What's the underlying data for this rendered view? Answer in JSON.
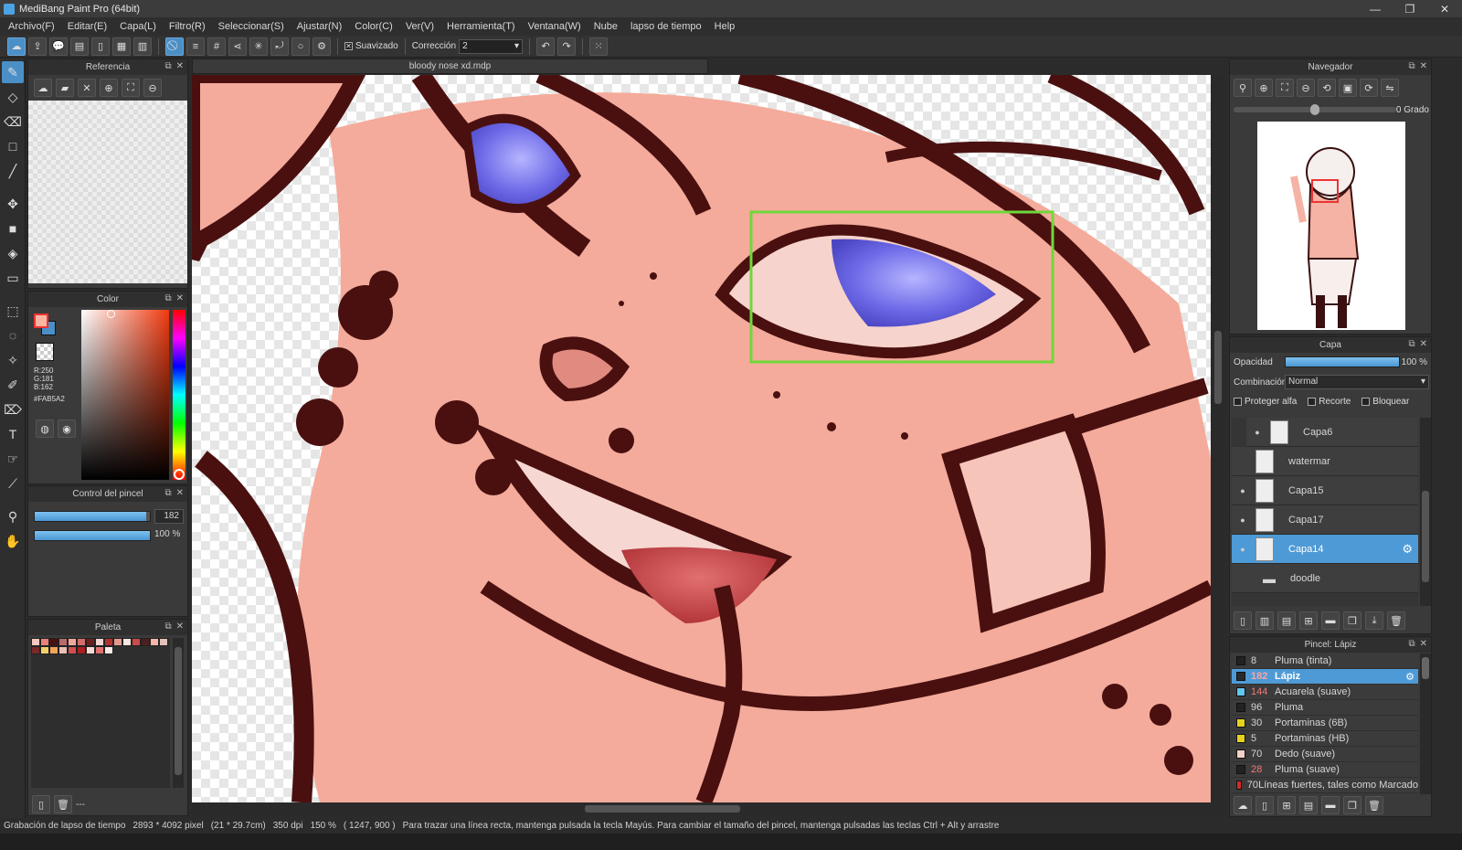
{
  "window": {
    "title": "MediBang Paint Pro (64bit)",
    "controls": [
      "—",
      "❐",
      "✕"
    ]
  },
  "menu": [
    "Archivo(F)",
    "Editar(E)",
    "Capa(L)",
    "Filtro(R)",
    "Seleccionar(S)",
    "Ajustar(N)",
    "Color(C)",
    "Ver(V)",
    "Herramienta(T)",
    "Ventana(W)",
    "Nube",
    "lapso de tiempo",
    "Help"
  ],
  "toolbar": {
    "suavizado_label": "Suavizado",
    "correccion_label": "Corrección",
    "correccion_value": "2"
  },
  "document": {
    "tab_title": "bloody nose xd.mdp"
  },
  "reference_panel": {
    "title": "Referencia"
  },
  "color_panel": {
    "title": "Color",
    "r": "R:250",
    "g": "G:181",
    "b": "B:162",
    "hex": "#FAB5A2",
    "fg_color": "#FAB5A2",
    "bg_color": "#4b8fc7"
  },
  "brush_control": {
    "title": "Control del pincel",
    "size": "182",
    "opacity": "100 %",
    "size_fraction": 0.97,
    "opacity_fraction": 1.0
  },
  "palette_panel": {
    "title": "Paleta",
    "footer": "---",
    "colors": [
      "#f6c9c0",
      "#e8807b",
      "#4a1111",
      "#b86b6b",
      "#f2a89a",
      "#d66b6b",
      "#6e1e1e",
      "#f1d7d2",
      "#b03030",
      "#e39a8e",
      "#f8e6e0",
      "#c94a4a",
      "#4a2020",
      "#f5b5a8",
      "#e4c0bb",
      "#7a2828",
      "#f0d26a",
      "#f2a35a",
      "#e8c0b8",
      "#d05050",
      "#a82020",
      "#f7dad4",
      "#e07070",
      "#fbeae6"
    ]
  },
  "navigator": {
    "title": "Navegador",
    "angle": "0 Grado"
  },
  "layer_panel": {
    "title": "Capa",
    "opacity_label": "Opacidad",
    "opacity_value": "100 %",
    "blend_label": "Combinación",
    "blend_value": "Normal",
    "protect_alpha": "Proteger alfa",
    "clipping": "Recorte",
    "lock": "Bloquear",
    "layers": [
      {
        "name": "Capa6",
        "visible": true,
        "selected": false
      },
      {
        "name": "watermar",
        "visible": false,
        "selected": false
      },
      {
        "name": "Capa15",
        "visible": true,
        "selected": false
      },
      {
        "name": "Capa17",
        "visible": true,
        "selected": false
      },
      {
        "name": "Capa14",
        "visible": true,
        "selected": true
      },
      {
        "name": "doodle",
        "visible": false,
        "selected": false
      }
    ]
  },
  "brush_panel": {
    "title": "Pincel: Lápiz",
    "brushes": [
      {
        "size": "8",
        "name": "Pluma (tinta)",
        "color": "#222222",
        "selected": false
      },
      {
        "size": "182",
        "name": "Lápiz",
        "color": "#2a2a2a",
        "selected": true
      },
      {
        "size": "144",
        "name": "Acuarela (suave)",
        "color": "#5ec8f0",
        "selected": false
      },
      {
        "size": "96",
        "name": "Pluma",
        "color": "#222222",
        "selected": false
      },
      {
        "size": "30",
        "name": "Portaminas (6B)",
        "color": "#e6d21e",
        "selected": false
      },
      {
        "size": "5",
        "name": "Portaminas (HB)",
        "color": "#e6d21e",
        "selected": false
      },
      {
        "size": "70",
        "name": "Dedo (suave)",
        "color": "#f1d1c8",
        "selected": false
      },
      {
        "size": "28",
        "name": "Pluma (suave)",
        "color": "#222222",
        "selected": false
      },
      {
        "size": "70",
        "name": "Líneas fuertes, tales como Marcado",
        "color": "#d42a2a",
        "selected": false
      }
    ]
  },
  "status": {
    "recording": "Grabación de lapso de tiempo",
    "size_px": "2893 * 4092 pixel",
    "size_cm": "(21 * 29.7cm)",
    "dpi": "350 dpi",
    "zoom": "150 %",
    "coords": "( 1247, 900 )",
    "hint": "Para trazar una línea recta, mantenga pulsada la tecla Mayús. Para cambiar el tamaño del pincel, mantenga pulsadas las teclas Ctrl + Alt y arrastre"
  }
}
